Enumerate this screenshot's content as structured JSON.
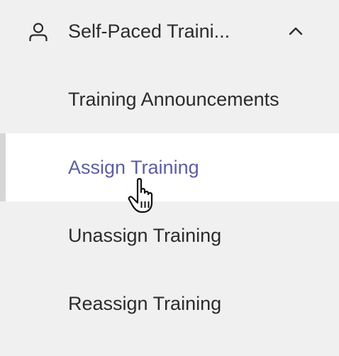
{
  "nav": {
    "section_label": "Self-Paced Traini...",
    "section_icon": "person-icon",
    "expand_icon": "chevron-up-icon",
    "items": [
      {
        "label": "Training Announcements",
        "active": false
      },
      {
        "label": "Assign Training",
        "active": true
      },
      {
        "label": "Unassign Training",
        "active": false
      },
      {
        "label": "Reassign Training",
        "active": false
      }
    ]
  },
  "colors": {
    "background": "#f0f0f0",
    "active_background": "#ffffff",
    "active_text": "#5b5fa0",
    "active_indicator": "#d6d6d6",
    "text": "#2b2b2b"
  },
  "cursor": "hand-pointer-icon"
}
